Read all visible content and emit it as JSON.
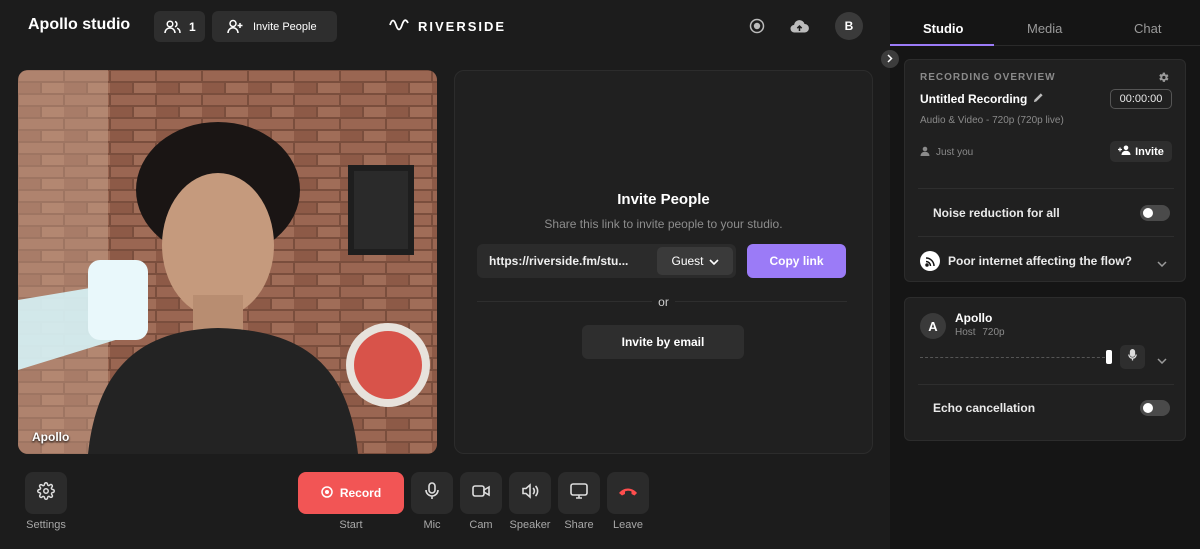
{
  "header": {
    "studio_name": "Apollo studio",
    "participant_count": "1",
    "invite_label": "Invite People",
    "logo_text": "RIVERSIDE",
    "avatar_initial": "B"
  },
  "video": {
    "participant_label": "Apollo"
  },
  "invite": {
    "title": "Invite People",
    "subtitle": "Share this link to invite people to your studio.",
    "link": "https://riverside.fm/stu...",
    "role": "Guest",
    "copy_label": "Copy link",
    "or_label": "or",
    "email_label": "Invite by email"
  },
  "controls": {
    "settings": "Settings",
    "record": "Record",
    "start": "Start",
    "mic": "Mic",
    "cam": "Cam",
    "speaker": "Speaker",
    "share": "Share",
    "leave": "Leave"
  },
  "sidebar": {
    "tabs": [
      "Studio",
      "Media",
      "Chat"
    ],
    "recording": {
      "heading": "RECORDING OVERVIEW",
      "title": "Untitled Recording",
      "timer": "00:00:00",
      "details": "Audio & Video - 720p (720p live)",
      "participants": "Just you",
      "invite_label": "Invite",
      "noise_label": "Noise reduction for all",
      "internet_label": "Poor internet affecting the flow?"
    },
    "host": {
      "initial": "A",
      "name": "Apollo",
      "role": "Host",
      "quality": "720p",
      "echo_label": "Echo cancellation"
    }
  },
  "colors": {
    "accent": "#9b7bf7",
    "record": "#f25555",
    "leave": "#ff4d4d",
    "background": "#1c1c1c",
    "sidebar": "#151515"
  }
}
